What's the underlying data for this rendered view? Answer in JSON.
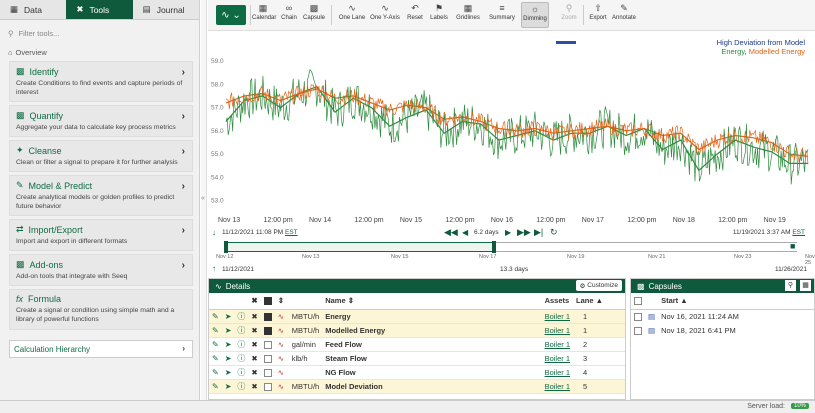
{
  "left_panel": {
    "tabs": [
      {
        "label": "Data",
        "icon": "database-icon"
      },
      {
        "label": "Tools",
        "icon": "wrench-icon"
      },
      {
        "label": "Journal",
        "icon": "book-icon"
      }
    ],
    "filter_placeholder": "Filter tools...",
    "overview_label": "Overview",
    "cards": [
      {
        "title": "Identify",
        "desc": "Create Conditions to find events and capture periods of interest",
        "icon": "identify-icon"
      },
      {
        "title": "Quantify",
        "desc": "Aggregate your data to calculate key process metrics",
        "icon": "bar-chart-icon"
      },
      {
        "title": "Cleanse",
        "desc": "Clean or filter a signal to prepare it for further analysis",
        "icon": "broom-icon"
      },
      {
        "title": "Model & Predict",
        "desc": "Create analytical models or golden profiles to predict future behavior",
        "icon": "pen-icon"
      },
      {
        "title": "Import/Export",
        "desc": "Import and export in different formats",
        "icon": "import-export-icon"
      },
      {
        "title": "Add-ons",
        "desc": "Add-on tools that integrate with Seeq",
        "icon": "puzzle-icon"
      },
      {
        "title": "Formula",
        "desc": "Create a signal or condition using simple math and a library of powerful functions",
        "icon": "fx-icon"
      }
    ],
    "calc_label": "Calculation Hierarchy"
  },
  "toolbar": {
    "items": [
      {
        "label": "Calendar",
        "icon": "calendar-icon"
      },
      {
        "label": "Chain",
        "icon": "chain-icon"
      },
      {
        "label": "Capsule",
        "icon": "capsule-icon"
      },
      {
        "label": "One Lane",
        "icon": "one-lane-icon"
      },
      {
        "label": "One Y-Axis",
        "icon": "one-y-axis-icon"
      },
      {
        "label": "Reset",
        "icon": "reset-icon"
      },
      {
        "label": "Labels",
        "icon": "tag-icon"
      },
      {
        "label": "Gridlines",
        "icon": "grid-icon"
      },
      {
        "label": "Summary",
        "icon": "summary-icon"
      },
      {
        "label": "Dimming",
        "icon": "dimming-icon"
      },
      {
        "label": "Zoom",
        "icon": "zoom-icon"
      },
      {
        "label": "Export",
        "icon": "export-icon"
      },
      {
        "label": "Annotate",
        "icon": "annotate-icon"
      }
    ]
  },
  "chart": {
    "legend_1": "High Deviation from Model",
    "legend_2_a": "Energy",
    "legend_2_sep": ", ",
    "legend_2_b": "Modelled Energy",
    "colors": {
      "energy": "#2e8b3e",
      "modelled": "#e0661a",
      "deviation": "#1e3a8a"
    }
  },
  "chart_data": {
    "type": "line",
    "ylim": [
      52.6,
      59.3
    ],
    "y_ticks": [
      "59.0",
      "58.0",
      "57.0",
      "56.0",
      "55.0",
      "54.0",
      "53.0"
    ],
    "x_ticks": [
      "Nov 13",
      "12:00 pm",
      "Nov 14",
      "12:00 pm",
      "Nov 15",
      "12:00 pm",
      "Nov 16",
      "12:00 pm",
      "Nov 17",
      "12:00 pm",
      "Nov 18",
      "12:00 pm",
      "Nov 19"
    ],
    "series": [
      {
        "name": "Energy",
        "color": "#2e8b3e",
        "x": [
          0,
          0.4,
          0.8,
          1.2,
          1.6,
          2,
          2.4,
          2.8,
          3.2,
          3.6,
          4,
          4.4,
          4.8,
          5.2,
          5.6,
          6,
          6.4,
          6.8,
          7.2,
          7.6,
          8,
          8.4,
          8.8,
          9.2,
          9.6,
          10,
          10.4,
          10.8,
          11.2,
          11.6,
          12,
          12.4,
          12.8
        ],
        "y": [
          56.4,
          57.3,
          57.5,
          57.0,
          57.6,
          57.9,
          56.8,
          57.4,
          57.0,
          56.2,
          56.6,
          56.9,
          55.9,
          56.4,
          56.3,
          55.6,
          55.8,
          56.0,
          55.6,
          55.9,
          55.9,
          56.2,
          55.8,
          56.1,
          55.2,
          55.6,
          54.3,
          55.0,
          55.6,
          55.3,
          55.1,
          54.6,
          54.6
        ]
      },
      {
        "name": "Modelled Energy",
        "color": "#e0661a",
        "x": [
          0,
          0.4,
          0.8,
          1.2,
          1.6,
          2,
          2.4,
          2.8,
          3.2,
          3.6,
          4,
          4.4,
          4.8,
          5.2,
          5.6,
          6,
          6.4,
          6.8,
          7.2,
          7.6,
          8,
          8.4,
          8.8,
          9.2,
          9.6,
          10,
          10.4,
          10.8,
          11.2,
          11.6,
          12,
          12.4,
          12.8
        ],
        "y": [
          57.2,
          57.5,
          57.6,
          57.3,
          57.6,
          57.8,
          57.4,
          57.5,
          57.2,
          56.9,
          57.1,
          57.0,
          56.5,
          56.6,
          56.4,
          56.1,
          56.0,
          56.1,
          55.9,
          56.0,
          56.1,
          56.2,
          56.0,
          56.1,
          55.8,
          55.9,
          55.2,
          55.6,
          55.8,
          55.7,
          55.5,
          55.0,
          54.9
        ]
      }
    ]
  },
  "timebar": {
    "start": "11/12/2021 11:08 PM",
    "start_tz": "EST",
    "duration": "6.2 days",
    "end": "11/19/2021 3:37 AM",
    "end_tz": "EST",
    "nav_ticks": [
      "Nov 12",
      "Nov 13",
      "Nov 15",
      "Nov 17",
      "Nov 19",
      "Nov 21",
      "Nov 23",
      "Nov 25"
    ],
    "display_start": "11/12/2021",
    "display_duration": "13.3 days",
    "display_end": "11/26/2021"
  },
  "details": {
    "title": "Details",
    "customize_label": "Customize",
    "headers": {
      "name": "Name",
      "assets": "Assets",
      "lane": "Lane"
    },
    "rows": [
      {
        "unit": "MBTU/h",
        "name": "Energy",
        "asset": "Boiler 1",
        "lane": "1",
        "selected": true,
        "checked": true
      },
      {
        "unit": "MBTU/h",
        "name": "Modelled Energy",
        "asset": "Boiler 1",
        "lane": "1",
        "selected": true,
        "checked": true
      },
      {
        "unit": "gal/min",
        "name": "Feed Flow",
        "asset": "Boiler 1",
        "lane": "2",
        "selected": false,
        "checked": false
      },
      {
        "unit": "klb/h",
        "name": "Steam Flow",
        "asset": "Boiler 1",
        "lane": "3",
        "selected": false,
        "checked": false
      },
      {
        "unit": "",
        "name": "NG Flow",
        "asset": "Boiler 1",
        "lane": "4",
        "selected": false,
        "checked": false
      },
      {
        "unit": "MBTU/h",
        "name": "Model Deviation",
        "asset": "Boiler 1",
        "lane": "5",
        "selected": true,
        "checked": false
      }
    ]
  },
  "capsules": {
    "title": "Capsules",
    "start_header": "Start",
    "rows": [
      "Nov 16, 2021 11:24 AM",
      "Nov 18, 2021 6:41 PM"
    ]
  },
  "status": {
    "server_load_label": "Server load:",
    "server_load_value": "10%"
  }
}
